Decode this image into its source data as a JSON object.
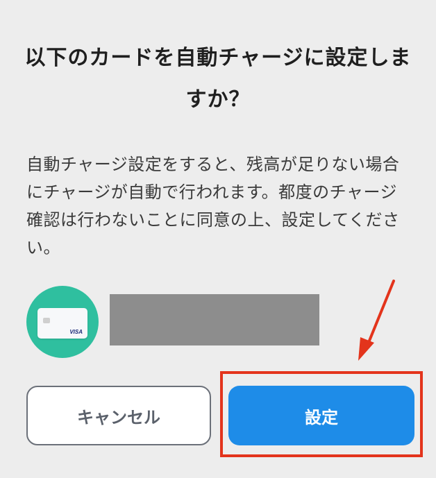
{
  "dialog": {
    "title": "以下のカードを自動チャージに設定しますか？",
    "description": "自動チャージ設定をすると、残高が足りない場合にチャージが自動で行われます。都度のチャージ確認は行わないことに同意の上、設定してください。"
  },
  "card": {
    "brand": "VISA",
    "icon": "credit-card-icon"
  },
  "buttons": {
    "cancel_label": "キャンセル",
    "set_label": "設定"
  },
  "colors": {
    "background": "#ededed",
    "primary": "#1e8ce8",
    "card_avatar": "#2fbf9f",
    "annotation": "#e3341c"
  }
}
